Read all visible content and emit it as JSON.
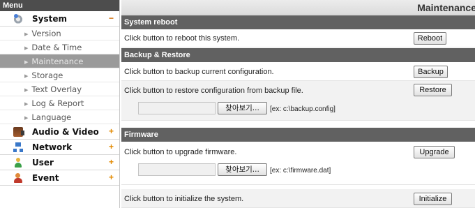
{
  "sidebar": {
    "header": "Menu",
    "groups": [
      {
        "label": "System",
        "toggle": "−",
        "icon": "gear-monitor-icon"
      },
      {
        "label": "Audio & Video",
        "toggle": "+",
        "icon": "camera-icon"
      },
      {
        "label": "Network",
        "toggle": "+",
        "icon": "network-icon"
      },
      {
        "label": "User",
        "toggle": "+",
        "icon": "user-icon"
      },
      {
        "label": "Event",
        "toggle": "+",
        "icon": "event-icon"
      }
    ],
    "system_items": [
      {
        "label": "Version"
      },
      {
        "label": "Date & Time"
      },
      {
        "label": "Maintenance",
        "active": true
      },
      {
        "label": "Storage"
      },
      {
        "label": "Text Overlay"
      },
      {
        "label": "Log & Report"
      },
      {
        "label": "Language"
      }
    ],
    "active_color": "#9a9a9a"
  },
  "main": {
    "title": "Maintenance",
    "reboot": {
      "heading": "System reboot",
      "text": "Click button to reboot this system.",
      "button": "Reboot"
    },
    "backup": {
      "heading": "Backup & Restore",
      "backup_text": "Click button to backup current configuration.",
      "backup_button": "Backup",
      "restore_text": "Click button to restore configuration from backup file.",
      "restore_button": "Restore",
      "file_value": "",
      "browse_label": "찾아보기...",
      "hint": "[ex: c:\\backup.config]"
    },
    "firmware": {
      "heading": "Firmware",
      "upgrade_text": "Click button to upgrade firmware.",
      "upgrade_button": "Upgrade",
      "file_value": "",
      "browse_label": "찾아보기...",
      "hint": "[ex: c:\\firmware.dat]",
      "init_text": "Click button to initialize the system.",
      "init_button": "Initialize"
    }
  },
  "colors": {
    "section_header_bg": "#616161",
    "menu_header_bg": "#4d4d4d",
    "accent_toggle": "#e38a00"
  }
}
